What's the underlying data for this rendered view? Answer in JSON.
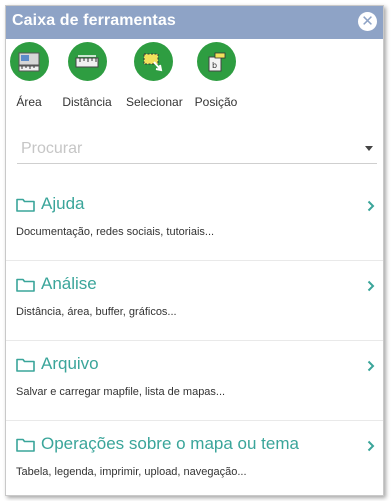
{
  "window": {
    "title": "Caixa de ferramentas"
  },
  "tools": [
    {
      "label": "Área",
      "icon": "ruler-area-icon"
    },
    {
      "label": "Distância",
      "icon": "ruler-distance-icon"
    },
    {
      "label": "Selecionar",
      "icon": "select-icon"
    },
    {
      "label": "Posição",
      "icon": "position-icon"
    }
  ],
  "search": {
    "placeholder": "Procurar"
  },
  "sections": [
    {
      "title": "Ajuda",
      "description": "Documentação, redes sociais, tutoriais..."
    },
    {
      "title": "Análise",
      "description": "Distância, área, buffer, gráficos..."
    },
    {
      "title": "Arquivo",
      "description": "Salvar e carregar mapfile, lista de mapas..."
    },
    {
      "title": "Operações sobre o mapa ou tema",
      "description": "Tabela, legenda, imprimir, upload, navegação..."
    }
  ],
  "colors": {
    "titlebar": "#8ea3c6",
    "tool_green": "#2e9d41",
    "section_teal": "#3aa59a"
  }
}
